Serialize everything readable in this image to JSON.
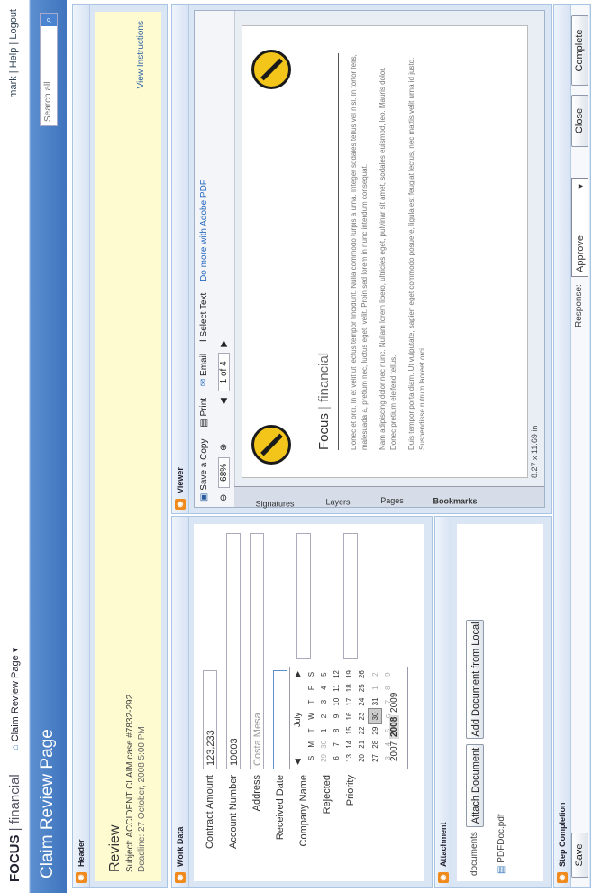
{
  "app": {
    "brand_main": "FOCUS",
    "brand_sep": " | ",
    "brand_sub": "financial",
    "nav_item": "Claim Review Page ▾"
  },
  "user_links": {
    "user": "mark",
    "help": "Help",
    "logout": "Logout",
    "sep": " | "
  },
  "page_title": "Claim Review Page",
  "search": {
    "placeholder": "Search all",
    "icon": "search-icon"
  },
  "header_panel": {
    "title": "Header",
    "review_title": "Review",
    "subject": "Subject: ACCIDENT CLAIM case #7832-292",
    "deadline": "Deadline: 27 October, 2008 5:00 PM",
    "instructions_link": "View Instructions"
  },
  "workdata": {
    "title": "Work Data",
    "fields": [
      {
        "label": "Contract Amount",
        "value": "123,233"
      },
      {
        "label": "Account Number",
        "value": "10003"
      },
      {
        "label": "Address",
        "value": "Costa Mesa"
      },
      {
        "label": "Received Date",
        "value": ""
      },
      {
        "label": "Company Name",
        "value": ""
      },
      {
        "label": "Rejected",
        "value": ""
      },
      {
        "label": "Priority",
        "value": ""
      }
    ],
    "calendar": {
      "month": "July",
      "weekdays": [
        "S",
        "M",
        "T",
        "W",
        "T",
        "F",
        "S"
      ],
      "weeks": [
        [
          "29",
          "30",
          "1",
          "2",
          "3",
          "4",
          "5"
        ],
        [
          "6",
          "7",
          "8",
          "9",
          "10",
          "11",
          "12"
        ],
        [
          "13",
          "14",
          "15",
          "16",
          "17",
          "18",
          "19"
        ],
        [
          "20",
          "21",
          "22",
          "23",
          "24",
          "25",
          "26"
        ],
        [
          "27",
          "28",
          "29",
          "30",
          "31",
          "1",
          "2"
        ],
        [
          "3",
          "4",
          "5",
          "6",
          "7",
          "8",
          "9"
        ]
      ],
      "years": [
        "2007",
        "2008",
        "2009"
      ]
    }
  },
  "attachment": {
    "title": "Attachment",
    "documents_label": "documents",
    "attach_button": "Attach Document",
    "local_button": "Add Document from Local",
    "file": "PDFDoc.pdf"
  },
  "viewer": {
    "title": "Viewer",
    "tools": {
      "save": "Save a Copy",
      "print": "Print",
      "email": "Email",
      "select": "Select Text",
      "zoom": "68%",
      "page": "1 of 4",
      "size": "8.27 x 11.69 in",
      "adobe_link": "Do more with Adobe PDF"
    },
    "side_tabs": [
      "Signatures",
      "Layers",
      "Pages",
      "Bookmarks"
    ],
    "doc_brand_main": "Focus",
    "doc_brand_sub": "financial",
    "paragraphs": [
      "Donec et orci. In et velit ut lectus tempor tincidunt. Nulla commodo turpis a urna. Integer sodales tellus vel nisl. In tortor felis, malesuada a, pretium nec, luctus eget, velit. Proin sed lorem in nunc interdum consequat.",
      "Nam adipiscing dolor nec nunc. Nullam lorem libero, ultricies eget, pulvinar sit amet, sodales euismod, leo. Mauris dolor. Donec pretium eleifend tellus.",
      "Duis tempor porta diam. Ut vulputate, sapien eget commodo posuere, ligula est feugiat lectus, nec mattis velit urna id justo. Suspendisse rutrum laoreet orci."
    ]
  },
  "step_completion": {
    "title": "Step Completion",
    "save_button": "Save",
    "response_label": "Response:",
    "response_value": "Approve",
    "close_button": "Close",
    "complete_button": "Complete"
  }
}
